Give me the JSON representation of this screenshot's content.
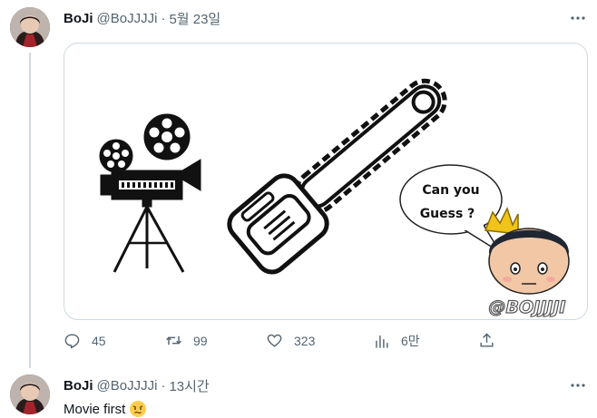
{
  "tweet": {
    "author_name": "BoJi",
    "handle": "@BoJJJJi",
    "dot": "·",
    "date": "5월 23일",
    "image": {
      "bubble_line1": "Can you",
      "bubble_line2": "Guess ?",
      "watermark": "@BOJJJJI"
    },
    "actions": {
      "replies": "45",
      "retweets": "99",
      "likes": "323",
      "views": "6만"
    }
  },
  "reply": {
    "author_name": "BoJi",
    "handle": "@BoJJJJi",
    "dot": "·",
    "time": "13시간",
    "text": "Movie first"
  },
  "colors": {
    "text_primary": "#0f1419",
    "text_secondary": "#536471",
    "border": "#cfd9de"
  },
  "icons": [
    "more-icon",
    "reply-icon",
    "retweet-icon",
    "like-icon",
    "views-icon",
    "share-icon",
    "film-camera-icon",
    "chainsaw-icon",
    "confused-emoji-icon"
  ]
}
